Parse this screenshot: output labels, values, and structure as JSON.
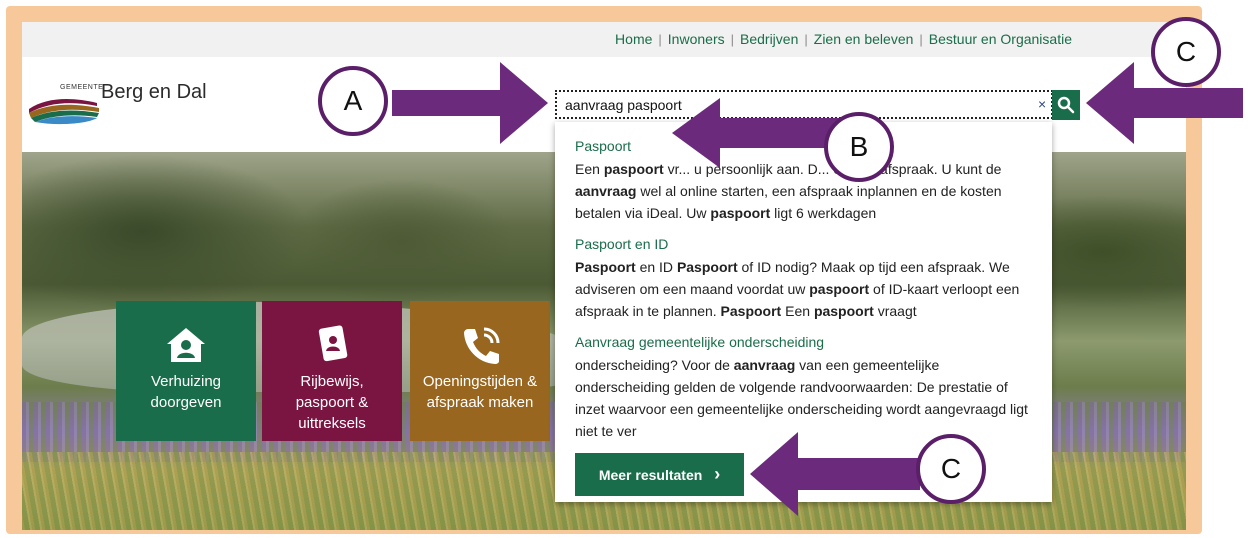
{
  "topnav": {
    "items": [
      "Home",
      "Inwoners",
      "Bedrijven",
      "Zien en beleven",
      "Bestuur en Organisatie"
    ],
    "separator": "|"
  },
  "logo": {
    "small": "GEMEENTE",
    "name": "Berg en Dal"
  },
  "search": {
    "value": "aanvraag paspoort",
    "clear_icon": "×"
  },
  "results": [
    {
      "title": "Paspoort",
      "text_html": "Een <b>paspoort</b> vr... u persoonlijk aan. D... een op afspraak. U kunt de <b>aanvraag</b> wel al online starten, een afspraak inplannen en de kosten betalen via iDeal. Uw <b>paspoort</b> ligt 6 werkdagen"
    },
    {
      "title": "Paspoort en ID",
      "text_html": "<b>Paspoort</b> en ID <b>Paspoort</b> of ID nodig? Maak op tijd een afspraak. We adviseren om een maand voordat uw <b>paspoort</b> of ID-kaart verloopt een afspraak in te plannen. <b>Paspoort</b> Een <b>paspoort</b> vraagt"
    },
    {
      "title": "Aanvraag gemeentelijke onderscheiding",
      "text_html": "onderscheiding? Voor de <b>aanvraag</b> van een gemeentelijke onderscheiding gelden de volgende randvoorwaarden: De prestatie of inzet waarvoor een gemeentelijke onderscheiding wordt aangevraagd ligt niet te ver"
    }
  ],
  "more_button": {
    "label": "Meer resultaten",
    "chevron": "›"
  },
  "tiles": [
    {
      "label": "Verhuizing doorgeven",
      "icon": "house-user-icon",
      "color": "#1a6d4a"
    },
    {
      "label": "Rijbewijs, paspoort & uittreksels",
      "icon": "id-book-icon",
      "color": "#7a1541"
    },
    {
      "label": "Openingstijden & afspraak maken",
      "icon": "phone-icon",
      "color": "#98661f"
    }
  ],
  "annotations": {
    "a": "A",
    "b": "B",
    "c_top": "C",
    "c_bottom": "C",
    "arrow_color": "#6b2a7b"
  },
  "colors": {
    "brand_green": "#1a6d4a",
    "frame": "#f6c89a"
  }
}
